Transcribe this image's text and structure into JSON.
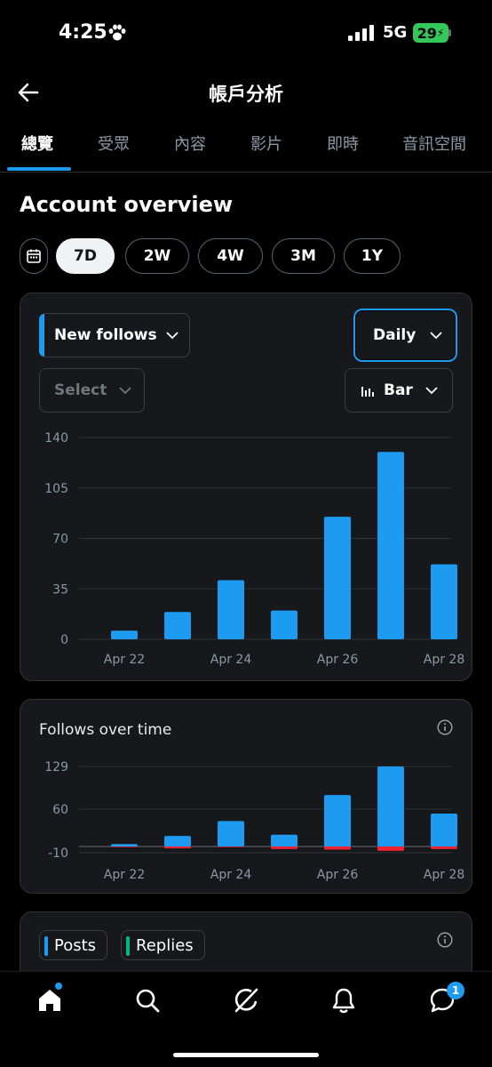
{
  "status_bar": {
    "time": "4:25",
    "network": "5G",
    "battery": "29"
  },
  "header": {
    "title": "帳戶分析"
  },
  "tabs": [
    {
      "label": "總覽",
      "active": true
    },
    {
      "label": "受眾"
    },
    {
      "label": "內容"
    },
    {
      "label": "影片"
    },
    {
      "label": "即時"
    },
    {
      "label": "音訊空間"
    }
  ],
  "section_title": "Account overview",
  "periods": [
    "7D",
    "2W",
    "4W",
    "3M",
    "1Y"
  ],
  "selected_period": "7D",
  "card1": {
    "metric_dropdown": "New follows",
    "interval_dropdown": "Daily",
    "compare_dropdown": "Select",
    "chart_type_dropdown": "Bar"
  },
  "card2": {
    "title": "Follows over time"
  },
  "card3": {
    "legend": [
      "Posts",
      "Replies"
    ]
  },
  "colors": {
    "accent": "#1d9bf0",
    "negative": "#f4212e",
    "replies": "#00ba7c",
    "background": "#000000",
    "card": "#16181c"
  },
  "icons": [
    "back-arrow-icon",
    "calendar-icon",
    "chevron-down-icon",
    "bar-chart-icon",
    "info-icon",
    "home-icon",
    "search-icon",
    "grok-icon",
    "bell-icon",
    "messages-icon"
  ],
  "nav": {
    "messages_badge": "1"
  },
  "chart_data": [
    {
      "type": "bar",
      "title": "",
      "series": [
        {
          "name": "New follows",
          "values": [
            6,
            19,
            41,
            20,
            85,
            130,
            52
          ]
        }
      ],
      "x_tick_labels": [
        "Apr 22",
        "Apr 24",
        "Apr 26",
        "Apr 28"
      ],
      "x_tick_indices": [
        0,
        2,
        4,
        6
      ],
      "y_ticks": [
        0,
        35,
        70,
        105,
        140
      ],
      "ylim": [
        0,
        140
      ],
      "grid": true
    },
    {
      "type": "bar",
      "title": "Follows over time",
      "series": [
        {
          "values": [
            4,
            17,
            41,
            19,
            83,
            129,
            53
          ]
        },
        {
          "values": [
            -1,
            -3,
            -1,
            -4,
            -5,
            -7,
            -4
          ]
        }
      ],
      "x_tick_labels": [
        "Apr 22",
        "Apr 24",
        "Apr 26",
        "Apr 28"
      ],
      "x_tick_indices": [
        0,
        2,
        4,
        6
      ],
      "y_ticks": [
        129,
        60,
        -10
      ],
      "ylim": [
        -10,
        129
      ],
      "grid": true
    }
  ]
}
